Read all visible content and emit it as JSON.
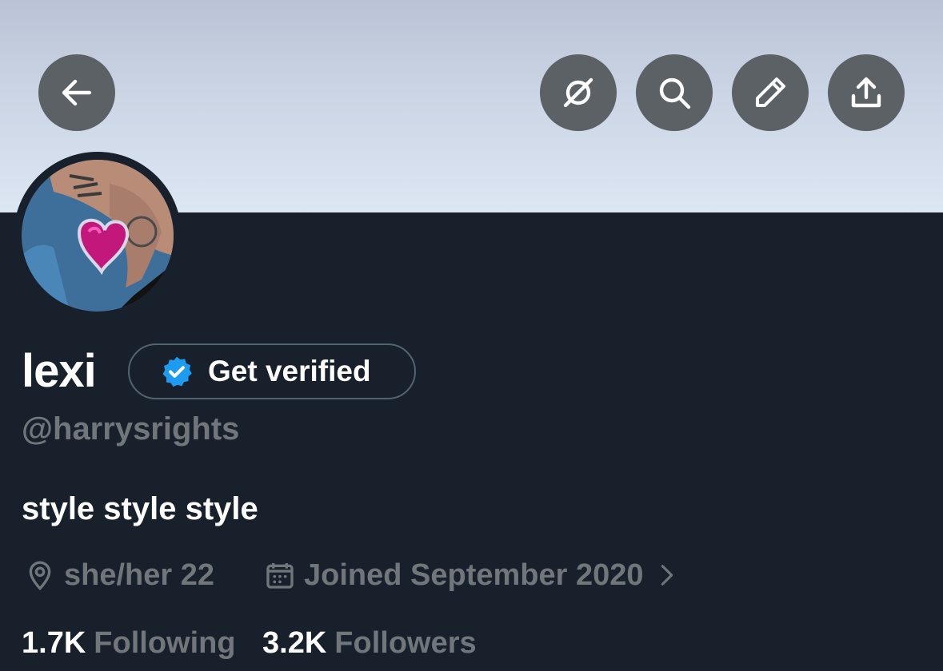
{
  "header": {
    "back_icon": "arrow-left-icon",
    "action_icons": [
      "grok-icon",
      "search-icon",
      "pencil-icon",
      "share-icon"
    ]
  },
  "profile": {
    "name": "lexi",
    "verify_label": "Get verified",
    "handle": "@harrysrights",
    "bio": "style style style",
    "location": "she/her 22",
    "joined": "Joined September 2020",
    "following_count": "1.7K",
    "following_label": "Following",
    "followers_count": "3.2K",
    "followers_label": "Followers"
  },
  "colors": {
    "background": "#18202b",
    "secondary_text": "#71767b",
    "verified_badge": "#1d9bf0",
    "icon_button": "#5c6166"
  }
}
